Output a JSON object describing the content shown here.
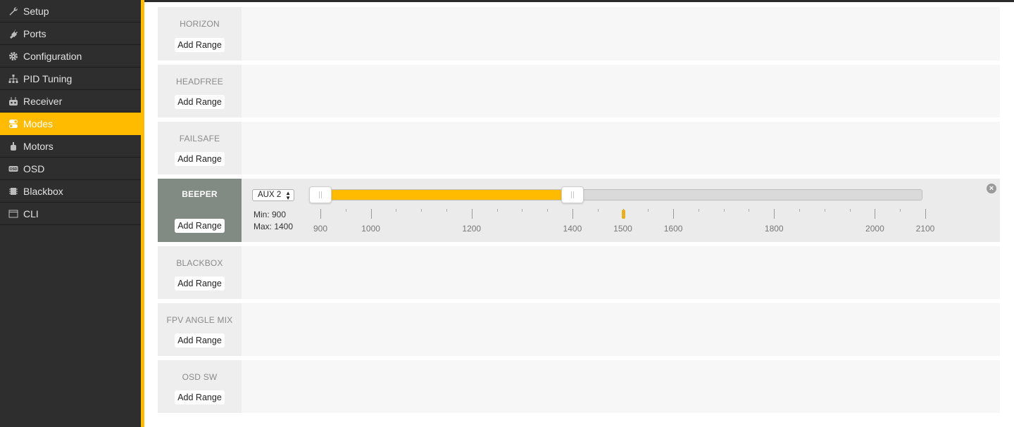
{
  "nav": {
    "items": [
      {
        "label": "Setup",
        "icon": "wrench-icon",
        "active": false
      },
      {
        "label": "Ports",
        "icon": "plug-icon",
        "active": false
      },
      {
        "label": "Configuration",
        "icon": "gear-icon",
        "active": false
      },
      {
        "label": "PID Tuning",
        "icon": "sitemap-icon",
        "active": false
      },
      {
        "label": "Receiver",
        "icon": "remote-icon",
        "active": false
      },
      {
        "label": "Modes",
        "icon": "toggle-icon",
        "active": true
      },
      {
        "label": "Motors",
        "icon": "motor-icon",
        "active": false
      },
      {
        "label": "OSD",
        "icon": "osd-icon",
        "active": false
      },
      {
        "label": "Blackbox",
        "icon": "blackbox-icon",
        "active": false
      },
      {
        "label": "CLI",
        "icon": "terminal-icon",
        "active": false
      }
    ]
  },
  "colors": {
    "accent": "#ffbb00",
    "sidebar": "#2e2e2e",
    "active_label_bg": "#828a84"
  },
  "modes": [
    {
      "name": "HORIZON",
      "add_label": "Add Range"
    },
    {
      "name": "HEADFREE",
      "add_label": "Add Range"
    },
    {
      "name": "FAILSAFE",
      "add_label": "Add Range"
    },
    {
      "name": "BEEPER",
      "add_label": "Add Range"
    },
    {
      "name": "BLACKBOX",
      "add_label": "Add Range"
    },
    {
      "name": "FPV ANGLE MIX",
      "add_label": "Add Range"
    },
    {
      "name": "OSD SW",
      "add_label": "Add Range"
    }
  ],
  "beeper_range": {
    "channel": "AUX 2",
    "min_label": "Min: 900",
    "max_label": "Max: 1400",
    "min": 900,
    "max": 1400,
    "current": 1500,
    "scale_min": 900,
    "scale_max": 2100,
    "tick_labels": [
      "900",
      "1000",
      "1200",
      "1400",
      "1500",
      "1600",
      "1800",
      "2000",
      "2100"
    ],
    "remove_icon": "close-circle-icon"
  }
}
